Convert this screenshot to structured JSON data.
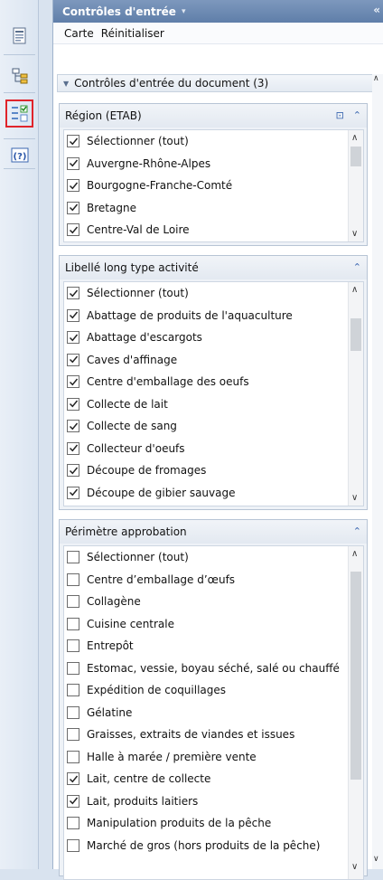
{
  "panel": {
    "title": "Contrôles d'entrée",
    "title_caret": "▾",
    "collapse_glyph": "«"
  },
  "menubar": {
    "map": "Carte",
    "reset": "Réinitialiser"
  },
  "document_controls": {
    "label": "Contrôles d'entrée du document (3)"
  },
  "controls": [
    {
      "title": "Région (ETAB)",
      "items": [
        {
          "label": "Sélectionner (tout)",
          "checked": true
        },
        {
          "label": "Auvergne-Rhône-Alpes",
          "checked": true
        },
        {
          "label": "Bourgogne-Franche-Comté",
          "checked": true
        },
        {
          "label": "Bretagne",
          "checked": true
        },
        {
          "label": "Centre-Val de Loire",
          "checked": true
        }
      ]
    },
    {
      "title": "Libellé long type activité",
      "items": [
        {
          "label": "Sélectionner (tout)",
          "checked": true
        },
        {
          "label": "Abattage de produits de l'aquaculture",
          "checked": true
        },
        {
          "label": "Abattage d'escargots",
          "checked": true
        },
        {
          "label": "Caves d'affinage",
          "checked": true
        },
        {
          "label": "Centre d'emballage des oeufs",
          "checked": true
        },
        {
          "label": "Collecte de lait",
          "checked": true
        },
        {
          "label": "Collecte de sang",
          "checked": true
        },
        {
          "label": "Collecteur d'oeufs",
          "checked": true
        },
        {
          "label": "Découpe de fromages",
          "checked": true
        },
        {
          "label": "Découpe de gibier sauvage",
          "checked": true
        }
      ]
    },
    {
      "title": "Périmètre approbation",
      "items": [
        {
          "label": "Sélectionner (tout)",
          "checked": false
        },
        {
          "label": "Centre d’emballage d’œufs",
          "checked": false
        },
        {
          "label": "Collagène",
          "checked": false
        },
        {
          "label": "Cuisine centrale",
          "checked": false
        },
        {
          "label": "Entrepôt",
          "checked": false
        },
        {
          "label": "Estomac, vessie, boyau séché, salé ou chauffé",
          "checked": false
        },
        {
          "label": "Expédition de coquillages",
          "checked": false
        },
        {
          "label": "Gélatine",
          "checked": false
        },
        {
          "label": "Graisses, extraits de viandes et issues",
          "checked": false
        },
        {
          "label": "Halle à marée / première vente",
          "checked": false
        },
        {
          "label": "Lait, centre de collecte",
          "checked": true
        },
        {
          "label": "Lait, produits laitiers",
          "checked": true
        },
        {
          "label": "Manipulation produits de la pêche",
          "checked": false
        },
        {
          "label": "Marché de gros (hors produits de la pêche)",
          "checked": false
        }
      ]
    }
  ],
  "colors": {
    "header_bg": "#6a88b2",
    "selected_tool_border": "#e0242b",
    "icon_blue": "#3a66b0"
  },
  "left_toolbar": {
    "tools": [
      {
        "icon": "document-structure-icon"
      },
      {
        "icon": "navigation-map-icon"
      },
      {
        "icon": "input-controls-icon",
        "selected": true
      },
      {
        "icon": "help-icon"
      }
    ]
  }
}
